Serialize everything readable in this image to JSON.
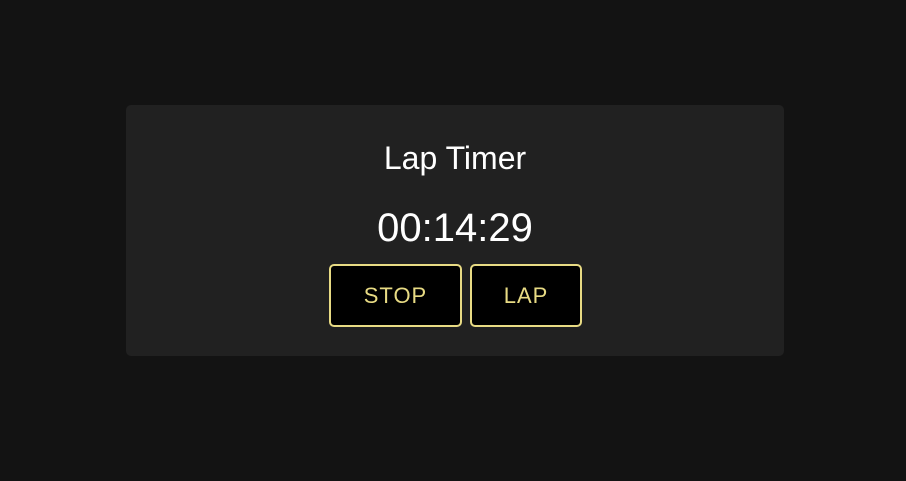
{
  "timer": {
    "title": "Lap Timer",
    "elapsed": "00:14:29"
  },
  "controls": {
    "stop_label": "STOP",
    "lap_label": "LAP"
  },
  "colors": {
    "page_background": "#131313",
    "card_background": "#212121",
    "text": "#ffffff",
    "accent": "#e8db84",
    "button_background": "#000000"
  }
}
